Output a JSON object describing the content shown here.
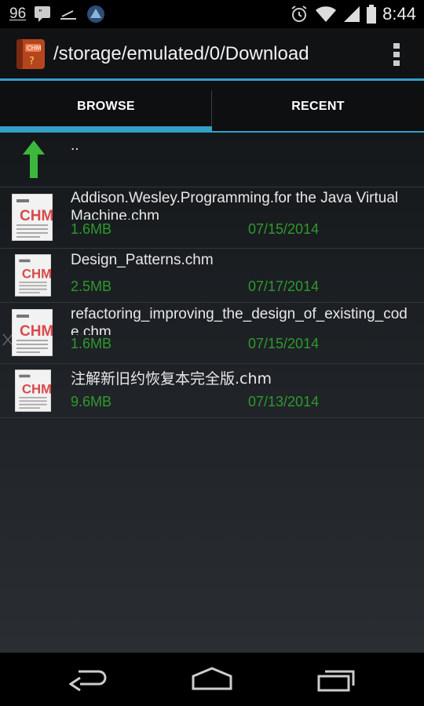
{
  "status": {
    "notif_count": "96",
    "time": "8:44"
  },
  "actionbar": {
    "title": "/storage/emulated/0/Download"
  },
  "tabs": [
    {
      "label": "BROWSE"
    },
    {
      "label": "RECENT"
    }
  ],
  "parent": {
    "label": ".."
  },
  "files": [
    {
      "name1": "Addison.Wesley.Programming.for the Java Virtual",
      "name2": "Machine.chm",
      "size": "1.6MB",
      "date": "07/15/2014"
    },
    {
      "name1": "Design_Patterns.chm",
      "size": "2.5MB",
      "date": "07/17/2014"
    },
    {
      "name1": "refactoring_improving_the_design_of_existing_cod",
      "name2": "e.chm",
      "size": "1.6MB",
      "date": "07/15/2014"
    },
    {
      "name1": "注解新旧约恢复本完全版.chm",
      "size": "9.6MB",
      "date": "07/13/2014"
    }
  ],
  "icons": {
    "file": "chm-file-icon",
    "up": "up-arrow-icon"
  },
  "colors": {
    "accent": "#33a0c8",
    "meta": "#2e9a2e"
  }
}
